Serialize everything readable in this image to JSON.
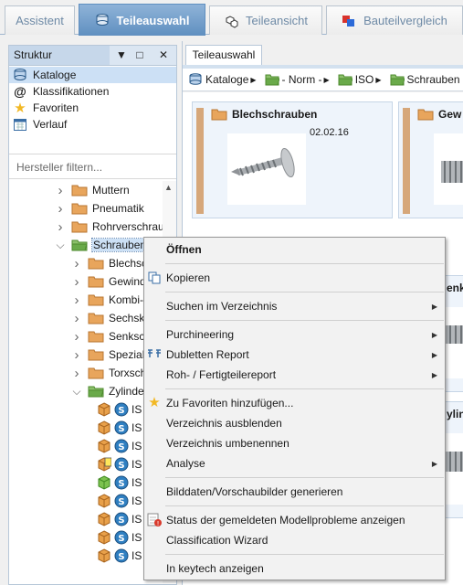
{
  "tabs": [
    {
      "label": "Assistent",
      "active": false
    },
    {
      "label": "Teileauswahl",
      "active": true
    },
    {
      "label": "Teileansicht",
      "active": false
    },
    {
      "label": "Bauteilvergleich",
      "active": false
    }
  ],
  "left_panel": {
    "title": "Struktur",
    "nav": [
      {
        "label": "Kataloge",
        "icon": "catalog-icon",
        "selected": true
      },
      {
        "label": "Klassifikationen",
        "icon": "at-icon",
        "selected": false
      },
      {
        "label": "Favoriten",
        "icon": "star-icon",
        "selected": false
      },
      {
        "label": "Verlauf",
        "icon": "calendar-icon",
        "selected": false
      }
    ],
    "filter_placeholder": "Hersteller filtern...",
    "tree": [
      {
        "label": "Muttern",
        "type": "folder",
        "level": 0,
        "arrow": "collapsed"
      },
      {
        "label": "Pneumatik",
        "type": "folder",
        "level": 0,
        "arrow": "collapsed"
      },
      {
        "label": "Rohrverschrau",
        "type": "folder",
        "level": 0,
        "arrow": "collapsed"
      },
      {
        "label": "Schraubens",
        "type": "folder-open",
        "level": 0,
        "arrow": "expanded",
        "selected": true
      },
      {
        "label": "Blechsc",
        "type": "folder",
        "level": 1,
        "arrow": "collapsed"
      },
      {
        "label": "Gewind",
        "type": "folder",
        "level": 1,
        "arrow": "collapsed"
      },
      {
        "label": "Kombi-",
        "type": "folder",
        "level": 1,
        "arrow": "collapsed"
      },
      {
        "label": "Sechska",
        "type": "folder",
        "level": 1,
        "arrow": "collapsed"
      },
      {
        "label": "Senksch",
        "type": "folder",
        "level": 1,
        "arrow": "collapsed"
      },
      {
        "label": "Spezials",
        "type": "folder",
        "level": 1,
        "arrow": "collapsed"
      },
      {
        "label": "Torxsch",
        "type": "folder",
        "level": 1,
        "arrow": "collapsed"
      },
      {
        "label": "Zylinder",
        "type": "folder-open",
        "level": 1,
        "arrow": "expanded"
      },
      {
        "label": "IS",
        "type": "part",
        "cube": "orange",
        "level": 2
      },
      {
        "label": "IS",
        "type": "part",
        "cube": "orange",
        "level": 2
      },
      {
        "label": "IS",
        "type": "part",
        "cube": "orange",
        "level": 2
      },
      {
        "label": "IS",
        "type": "part",
        "cube": "orange-doc",
        "level": 2
      },
      {
        "label": "IS",
        "type": "part",
        "cube": "green",
        "level": 2
      },
      {
        "label": "IS",
        "type": "part",
        "cube": "orange",
        "level": 2
      },
      {
        "label": "IS",
        "type": "part",
        "cube": "orange",
        "level": 2
      },
      {
        "label": "IS",
        "type": "part",
        "cube": "orange",
        "level": 2
      },
      {
        "label": "IS",
        "type": "part",
        "cube": "orange",
        "level": 2
      }
    ]
  },
  "right_panel": {
    "tab": "Teileauswahl",
    "breadcrumbs": [
      "Kataloge",
      "- Norm -",
      "ISO",
      "Schrauben"
    ],
    "cards": [
      {
        "title": "Blechschrauben",
        "date": "02.02.16"
      },
      {
        "title": "Gew",
        "date": ""
      },
      {
        "title": "",
        "date": ""
      },
      {
        "title": "enk",
        "date": ""
      },
      {
        "title": "",
        "date": ""
      },
      {
        "title": "ylin",
        "date": ""
      }
    ]
  },
  "context_menu": {
    "items": [
      {
        "label": "Öffnen",
        "bold": true,
        "submenu": false,
        "icon": ""
      },
      {
        "separator": true
      },
      {
        "label": "Kopieren",
        "submenu": false,
        "icon": "copy-icon"
      },
      {
        "separator": true
      },
      {
        "label": "Suchen im Verzeichnis",
        "submenu": true,
        "icon": ""
      },
      {
        "separator": true
      },
      {
        "label": "Purchineering",
        "submenu": true,
        "icon": ""
      },
      {
        "label": "Dubletten Report",
        "submenu": true,
        "icon": "duplicate-report-icon"
      },
      {
        "label": "Roh- / Fertigteilereport",
        "submenu": true,
        "icon": ""
      },
      {
        "separator": true
      },
      {
        "label": "Zu Favoriten hinzufügen...",
        "submenu": false,
        "icon": "star-icon"
      },
      {
        "label": "Verzeichnis ausblenden",
        "submenu": false,
        "icon": ""
      },
      {
        "label": "Verzeichnis umbenennen",
        "submenu": false,
        "icon": ""
      },
      {
        "label": "Analyse",
        "submenu": true,
        "icon": ""
      },
      {
        "separator": true
      },
      {
        "label": "Bilddaten/Vorschaubilder generieren",
        "submenu": false,
        "icon": ""
      },
      {
        "separator": true
      },
      {
        "label": "Status der gemeldeten Modellprobleme anzeigen",
        "submenu": false,
        "icon": "model-problem-icon"
      },
      {
        "label": "Classification Wizard",
        "submenu": false,
        "icon": ""
      },
      {
        "separator": true
      },
      {
        "label": "In keytech anzeigen",
        "submenu": false,
        "icon": ""
      }
    ]
  },
  "colors": {
    "active_tab": "#6f9cc9",
    "selection": "#cce0f5",
    "folder": "#e8a55c",
    "folder_open": "#6aaa4a",
    "card_bg": "#eef4fb",
    "card_strip": "#d6a77a"
  }
}
